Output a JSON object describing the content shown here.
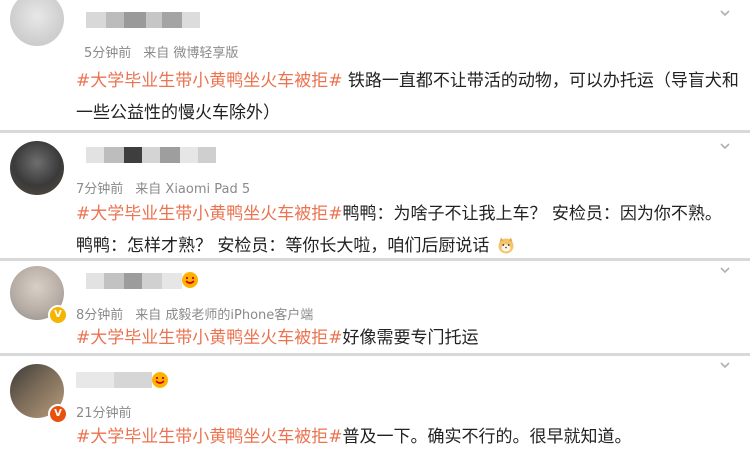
{
  "comments": [
    {
      "meta_time": "5分钟前",
      "meta_source": "来自 微博轻享版",
      "hashtag": "#大学毕业生带小黄鸭坐火车被拒#",
      "line1_rest": " 铁路一直都不让带活的动物，可以办托运（导盲犬和",
      "line2": "一些公益性的慢火车除外）"
    },
    {
      "meta_time": "7分钟前",
      "meta_source": "来自 Xiaomi Pad 5",
      "hashtag": "#大学毕业生带小黄鸭坐火车被拒#",
      "line1_rest": "鸭鸭：为啥子不让我上车？ 安检员：因为你不熟。",
      "line2": "鸭鸭：怎样才熟？ 安检员：等你长大啦，咱们后厨说话"
    },
    {
      "meta_time": "8分钟前",
      "meta_source": "来自 成毅老师的iPhone客户端",
      "hashtag": "#大学毕业生带小黄鸭坐火车被拒#",
      "line1_rest": "好像需要专门托运"
    },
    {
      "meta_time": "21分钟前",
      "meta_source": "",
      "hashtag": "#大学毕业生带小黄鸭坐火车被拒#",
      "line1_rest": "普及一下。确实不行的。很早就知道。"
    }
  ],
  "colors": {
    "hashtag": "#eb7350",
    "meta": "#8a8a8a",
    "separator": "#d9d9d9",
    "vip_badge": "#f5b400"
  },
  "icons": [
    "chevron-down-icon",
    "verified-badge-icon",
    "shiba-emoji-icon",
    "fan-badge-icon"
  ]
}
